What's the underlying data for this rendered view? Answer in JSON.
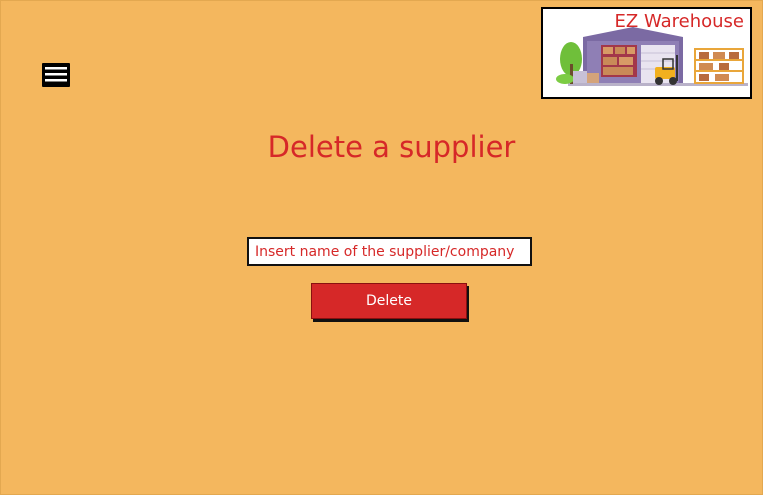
{
  "header": {
    "logo_text": "EZ Warehouse",
    "menu_icon": "hamburger-menu-icon"
  },
  "main": {
    "title": "Delete a supplier",
    "supplier_input": {
      "value": "",
      "placeholder": "Insert name of the supplier/company"
    },
    "delete_label": "Delete"
  },
  "colors": {
    "background": "#F4B75E",
    "accent": "#D62828"
  }
}
